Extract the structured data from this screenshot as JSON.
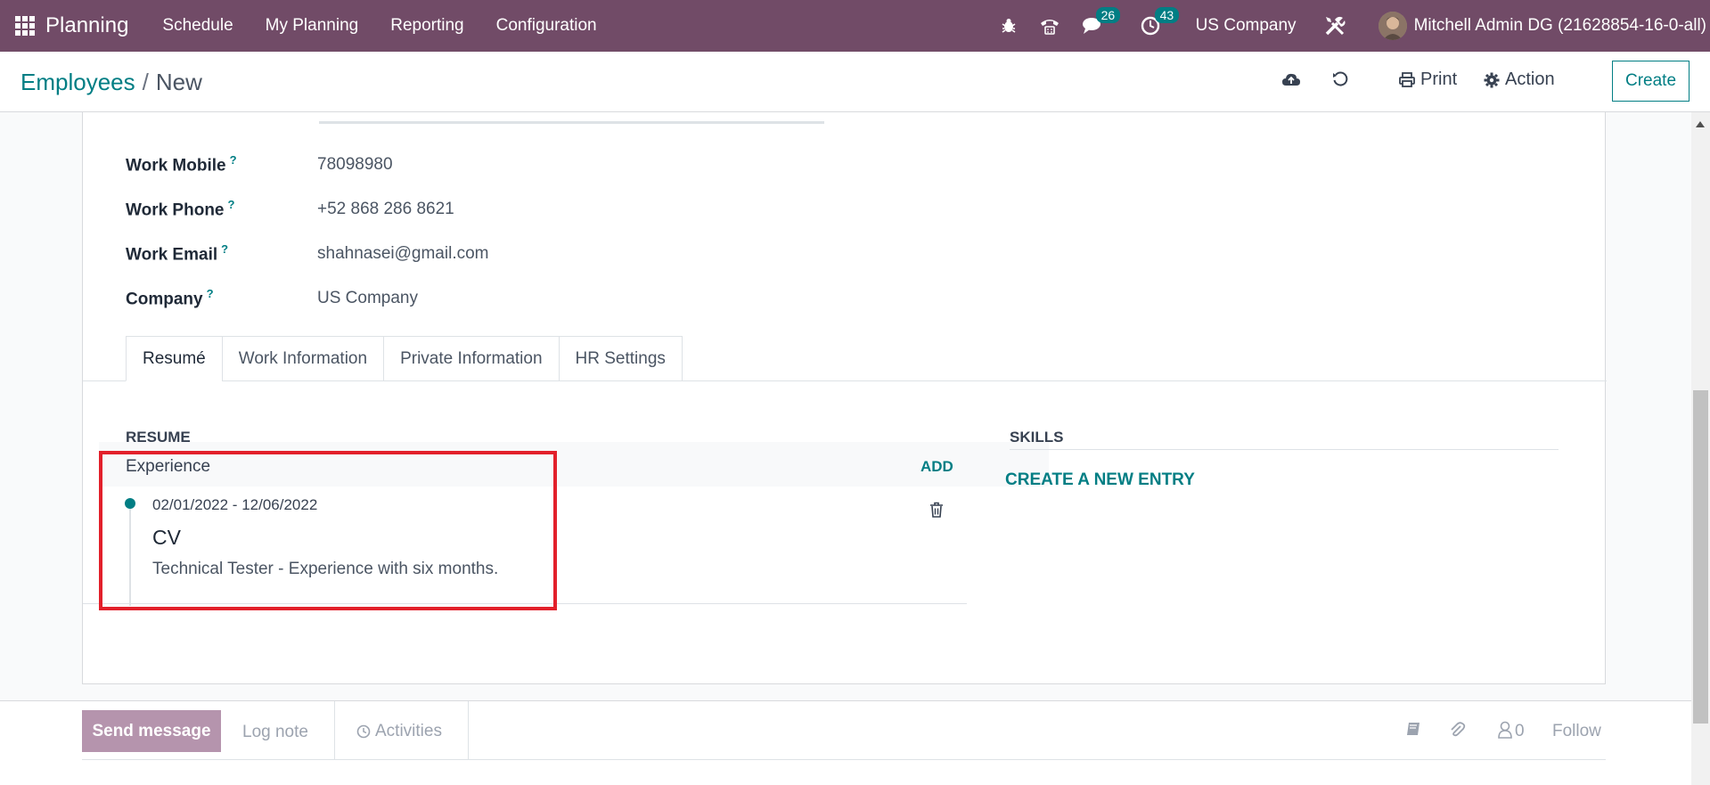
{
  "topnav": {
    "brand": "Planning",
    "menu": [
      "Schedule",
      "My Planning",
      "Reporting",
      "Configuration"
    ],
    "messages_count": "26",
    "activities_count": "43",
    "company": "US Company",
    "user": "Mitchell Admin DG (21628854-16-0-all)",
    "icons": [
      "apps-icon",
      "bug-icon",
      "phone-icon",
      "chat-icon",
      "clock-icon",
      "tools-icon"
    ]
  },
  "control_panel": {
    "breadcrumb_parent": "Employees",
    "breadcrumb_separator": "/",
    "breadcrumb_current": "New",
    "print_label": "Print",
    "action_label": "Action",
    "create_label": "Create"
  },
  "form": {
    "fields": [
      {
        "label": "Work Mobile",
        "help": "?",
        "value": "78098980"
      },
      {
        "label": "Work Phone",
        "help": "?",
        "value": "+52 868 286 8621"
      },
      {
        "label": "Work Email",
        "help": "?",
        "value": "shahnasei@gmail.com"
      },
      {
        "label": "Company",
        "help": "?",
        "value": "US Company"
      }
    ],
    "tabs": [
      "Resumé",
      "Work Information",
      "Private Information",
      "HR Settings"
    ],
    "active_tab": "Resumé",
    "resume": {
      "title": "RESUME",
      "group": "Experience",
      "add_label": "ADD",
      "entry": {
        "dates": "02/01/2022 - 12/06/2022",
        "name": "CV",
        "description": "Technical Tester - Experience with six months."
      }
    },
    "skills": {
      "title": "SKILLS",
      "create_label": "CREATE A NEW ENTRY"
    }
  },
  "chatter": {
    "send_message": "Send message",
    "log_note": "Log note",
    "activities": "Activities",
    "followers_count": "0",
    "follow": "Follow"
  },
  "colors": {
    "nav_bg": "#714b67",
    "accent": "#017e84",
    "highlight_border": "#e2202b"
  }
}
